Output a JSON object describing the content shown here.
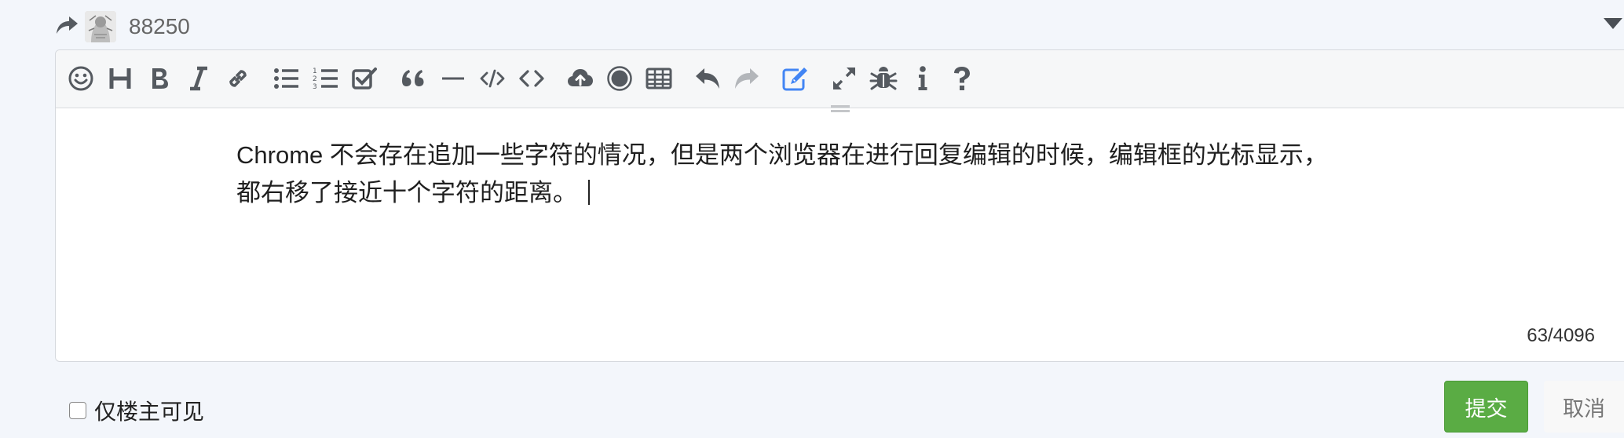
{
  "reply": {
    "username": "88250"
  },
  "editor": {
    "toolbar": [
      {
        "name": "emoji-icon"
      },
      {
        "name": "heading-icon"
      },
      {
        "name": "bold-icon"
      },
      {
        "name": "italic-icon"
      },
      {
        "name": "link-icon"
      },
      {
        "name": "unordered-list-icon"
      },
      {
        "name": "ordered-list-icon"
      },
      {
        "name": "check-list-icon"
      },
      {
        "name": "quote-icon"
      },
      {
        "name": "horizontal-rule-icon"
      },
      {
        "name": "inline-code-icon"
      },
      {
        "name": "code-block-icon"
      },
      {
        "name": "upload-icon"
      },
      {
        "name": "record-icon"
      },
      {
        "name": "table-icon"
      },
      {
        "name": "undo-icon"
      },
      {
        "name": "redo-icon"
      },
      {
        "name": "edit-mode-icon"
      },
      {
        "name": "fullscreen-icon"
      },
      {
        "name": "debug-icon"
      },
      {
        "name": "info-icon"
      },
      {
        "name": "help-icon"
      }
    ],
    "content": "Chrome 不会存在追加一些字符的情况，但是两个浏览器在进行回复编辑的时候，编辑框的光标显示，都右移了接近十个字符的距离。",
    "char_count": "63/4096"
  },
  "footer": {
    "only_op_label": "仅楼主可见",
    "submit_label": "提交",
    "cancel_label": "取消"
  },
  "colors": {
    "submit": "#5aac44",
    "toolbar_active": "#4285f4",
    "icon": "#555a60"
  }
}
